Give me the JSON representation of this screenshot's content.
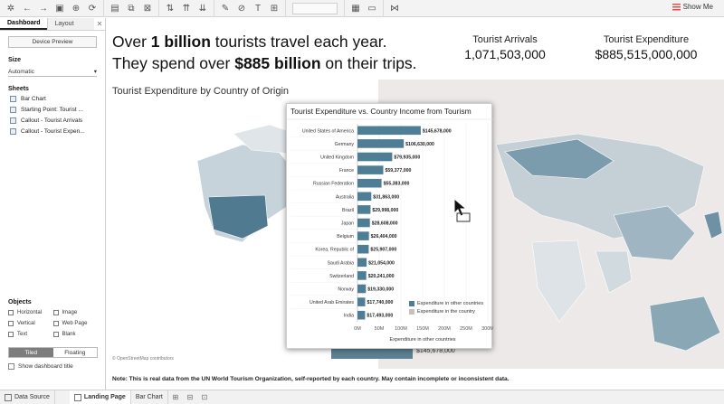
{
  "toolbar": {
    "show_me_label": "Show Me"
  },
  "left_pane": {
    "tabs": [
      "Dashboard",
      "Layout"
    ],
    "device_preview_label": "Device Preview",
    "size_title": "Size",
    "size_value": "Automatic",
    "sheets_title": "Sheets",
    "sheets": [
      "Bar Chart",
      "Starting Point: Tourist ...",
      "Callout - Tourist Arrivals",
      "Callout - Tourist Expen..."
    ],
    "objects_title": "Objects",
    "objects": [
      "Horizontal",
      "Image",
      "Vertical",
      "Web Page",
      "Text",
      "Blank"
    ],
    "layout_modes": [
      "Tiled",
      "Floating"
    ],
    "show_title_label": "Show dashboard title"
  },
  "dashboard": {
    "headline_pre1": "Over ",
    "headline_bold1": "1 billion",
    "headline_post1": " tourists travel each year.",
    "headline_pre2": "They spend over ",
    "headline_bold2": "$885 billion",
    "headline_post2": " on their trips.",
    "kpi_arrivals_label": "Tourist Arrivals",
    "kpi_arrivals_value": "1,071,503,000",
    "kpi_expenditure_label": "Tourist Expenditure",
    "kpi_expenditure_value": "$885,515,000,000",
    "map_title": "Tourist Expenditure by Country of Origin",
    "map_attribution": "© OpenStreetMap contributors",
    "map_callout_value": "$145,678,000",
    "note": "Note: This is real data from the UN World Tourism Organization, self-reported by each country. May contain incomplete or inconsistent data."
  },
  "chart_data": {
    "type": "bar",
    "title": "Tourist Expenditure vs. Country Income from Tourism",
    "xlabel": "Expenditure in other countries",
    "categories": [
      "United States of America",
      "Germany",
      "United Kingdom",
      "France",
      "Russian Federation",
      "Australia",
      "Brazil",
      "Japan",
      "Belgium",
      "Korea, Republic of",
      "Saudi Arabia",
      "Switzerland",
      "Norway",
      "United Arab Emirates",
      "India"
    ],
    "values": [
      145678000,
      106630000,
      79935000,
      59377000,
      55383000,
      31863000,
      29998000,
      28608000,
      26404000,
      25907000,
      21054000,
      20241000,
      19330000,
      17740000,
      17493000
    ],
    "value_labels": [
      "$145,678,000",
      "$106,630,000",
      "$79,935,000",
      "$59,377,000",
      "$55,383,000",
      "$31,863,000",
      "$29,998,000",
      "$28,608,000",
      "$26,404,000",
      "$25,907,000",
      "$21,054,000",
      "$20,241,000",
      "$19,330,000",
      "$17,740,000",
      "$17,493,000"
    ],
    "x_ticks": [
      "0M",
      "50M",
      "100M",
      "150M",
      "200M",
      "250M",
      "300M"
    ],
    "xlim": [
      0,
      300000000
    ],
    "legend": [
      "Expenditure in other countries",
      "Expenditure in the country"
    ],
    "legend_placement": "bottom-right",
    "colors": {
      "bar": "#4e7d96",
      "in_country": "#c9c0bd"
    }
  },
  "bottom_tabs": {
    "data_source": "Data Source",
    "landing_page": "Landing Page",
    "bar_chart": "Bar Chart"
  }
}
